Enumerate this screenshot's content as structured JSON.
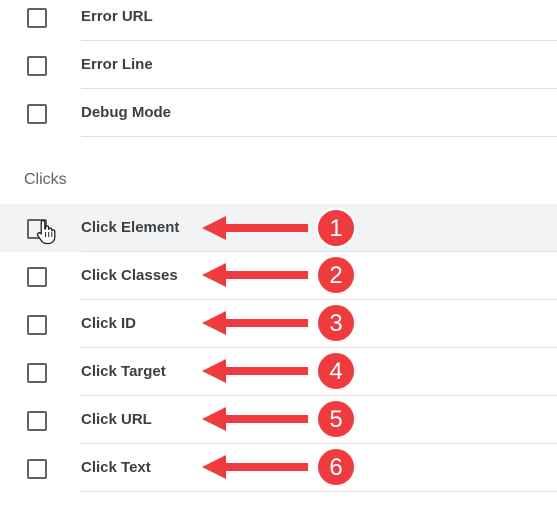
{
  "variables_top": [
    {
      "label": "Error URL"
    },
    {
      "label": "Error Line"
    },
    {
      "label": "Debug Mode"
    }
  ],
  "clicks_section": {
    "title": "Clicks",
    "items": [
      {
        "label": "Click Element",
        "checked": false,
        "hovered": true
      },
      {
        "label": "Click Classes",
        "checked": false
      },
      {
        "label": "Click ID",
        "checked": false
      },
      {
        "label": "Click Target",
        "checked": false
      },
      {
        "label": "Click URL",
        "checked": false
      },
      {
        "label": "Click Text",
        "checked": false
      }
    ]
  },
  "annotations": {
    "arrow_color": "#ef3b3e",
    "badges": [
      "1",
      "2",
      "3",
      "4",
      "5",
      "6"
    ]
  },
  "colors": {
    "checkbox_border": "#5f6368",
    "hover_background": "#f1f3f4",
    "divider": "#e0e0e0"
  }
}
